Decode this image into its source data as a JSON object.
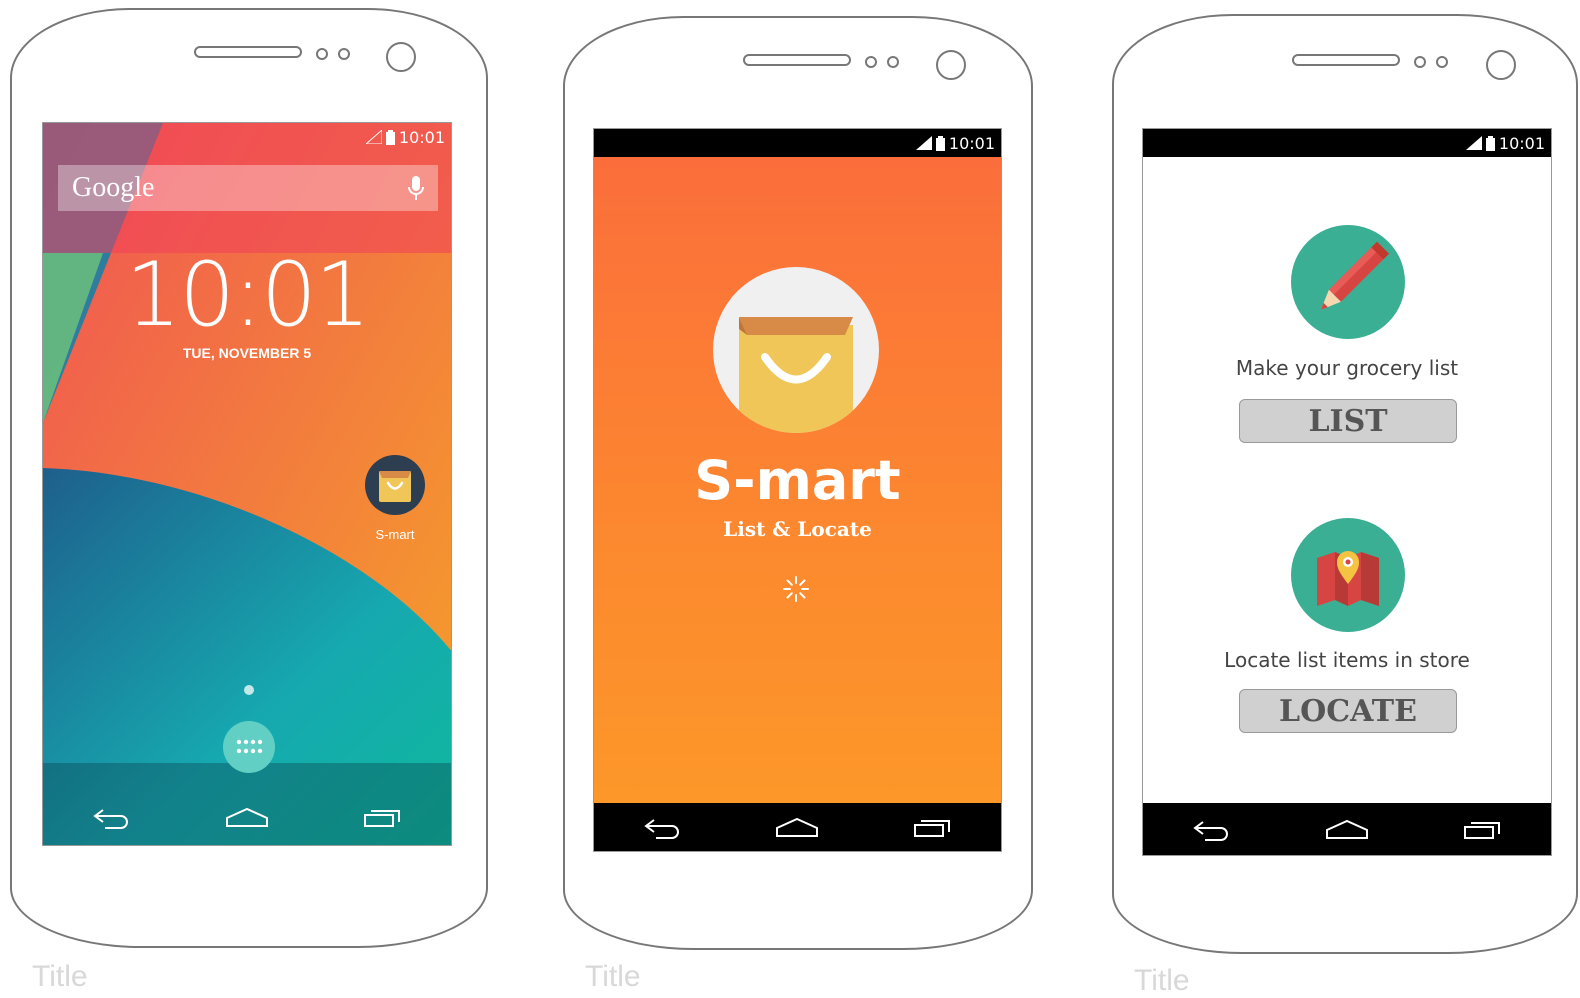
{
  "phones": [
    {
      "status": {
        "time": "10:01"
      },
      "home": {
        "search_brand": "Google",
        "clock": "10:01",
        "date": "TUE, NOVEMBER 5",
        "app_label": "S-mart"
      },
      "caption": "Title"
    },
    {
      "status": {
        "time": "10:01"
      },
      "splash": {
        "title": "S-mart",
        "subtitle": "List & Locate"
      },
      "caption": "Title"
    },
    {
      "status": {
        "time": "10:01"
      },
      "menu": {
        "list_text": "Make your grocery list",
        "list_button": "LIST",
        "locate_text": "Locate list items in store",
        "locate_button": "LOCATE"
      },
      "caption": "Title"
    }
  ],
  "colors": {
    "splash_orange": "#fb7a3a",
    "feature_teal": "#3aaf94",
    "button_gray": "#d0d0d0"
  },
  "icons": [
    "mic-icon",
    "shopping-bag-icon",
    "app-drawer-icon",
    "back-icon",
    "home-icon",
    "recents-icon",
    "pencil-icon",
    "map-pin-icon",
    "signal-icon",
    "battery-icon"
  ]
}
